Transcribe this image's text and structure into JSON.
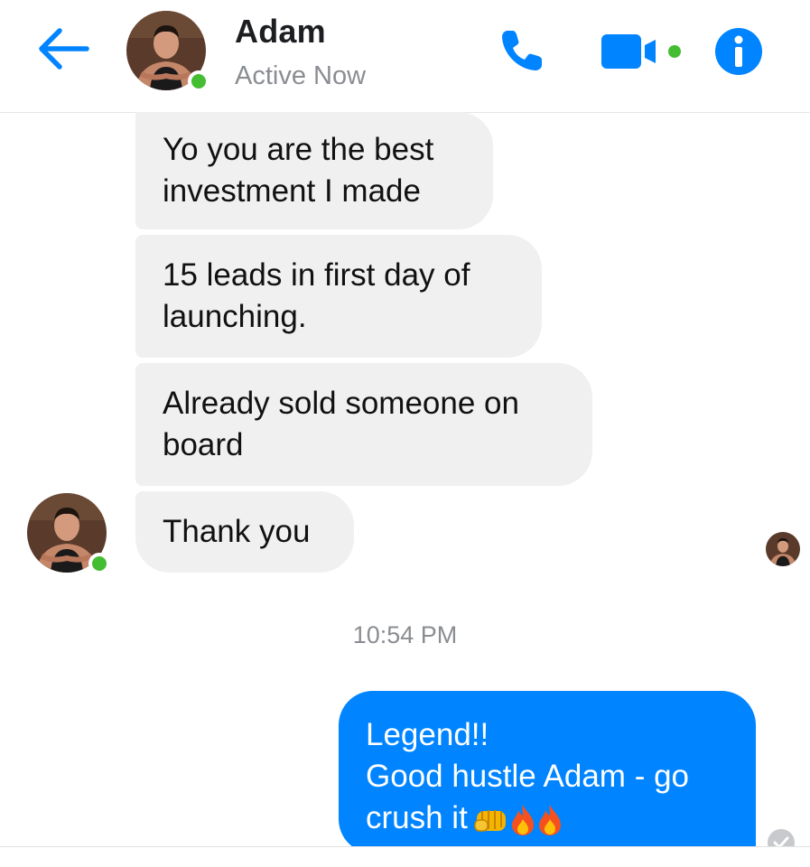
{
  "header": {
    "contact_name": "Adam",
    "status": "Active Now",
    "icons": {
      "back": "back-arrow-icon",
      "call": "phone-icon",
      "video": "video-camera-icon",
      "info": "info-icon"
    }
  },
  "messages": [
    {
      "sender": "Adam",
      "text": "Yo you are the best\ninvestment I made"
    },
    {
      "sender": "Adam",
      "text": "15 leads in first day of\nlaunching."
    },
    {
      "sender": "Adam",
      "text": "Already sold someone on\nboard"
    },
    {
      "sender": "Adam",
      "text": "Thank you"
    }
  ],
  "timestamp": "10:54 PM",
  "outgoing": {
    "line1": "Legend!!",
    "line2": "Good hustle Adam - go",
    "line3": "crush it",
    "emojis": [
      "fist-emoji",
      "fire-emoji",
      "fire-emoji"
    ]
  },
  "colors": {
    "accent": "#0084ff",
    "incoming_bubble": "#f0f0f0",
    "presence": "#44bd32",
    "secondary_text": "#8a8d91"
  }
}
